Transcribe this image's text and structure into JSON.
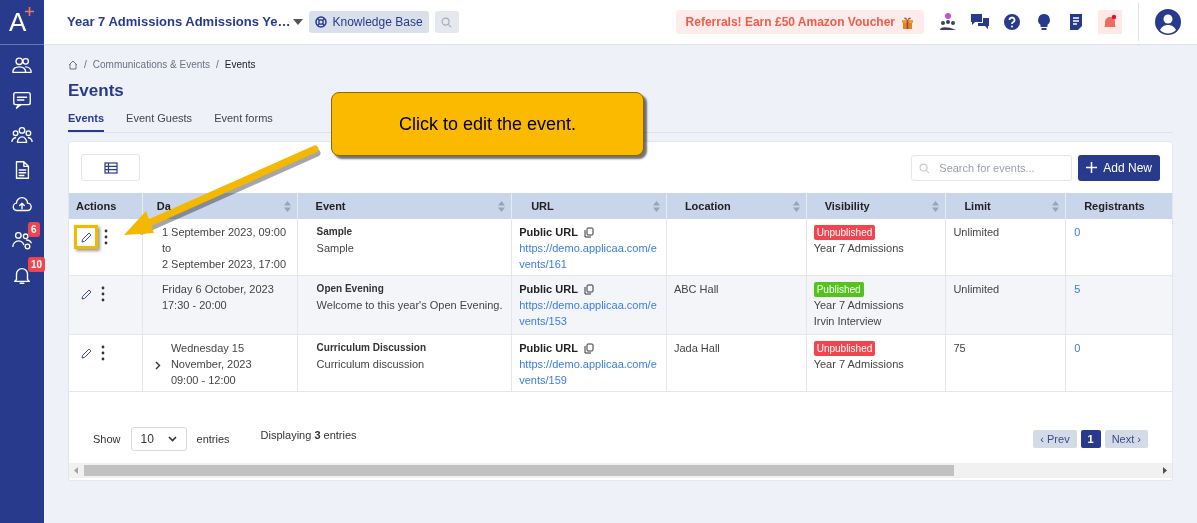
{
  "topbar": {
    "workspace": "Year 7 Admissions Admissions Ye…",
    "knowledge_base": "Knowledge Base",
    "referral": "Referrals! Earn £50 Amazon Voucher"
  },
  "sidebar": {
    "logo": "A",
    "items": [
      {
        "kind": "people"
      },
      {
        "kind": "chat"
      },
      {
        "kind": "group"
      },
      {
        "kind": "document"
      },
      {
        "kind": "upload"
      },
      {
        "kind": "group-settings",
        "badge": "6"
      },
      {
        "kind": "bell",
        "badge": "10"
      }
    ]
  },
  "breadcrumb": {
    "separator": "/",
    "items": [
      "Communications & Events",
      "Events"
    ]
  },
  "page_title": "Events",
  "tabs": [
    {
      "label": "Events",
      "selected": true
    },
    {
      "label": "Event Guests",
      "selected": false
    },
    {
      "label": "Event forms",
      "selected": false
    }
  ],
  "callout": "Click to edit the event.",
  "search": {
    "placeholder": "Search for events..."
  },
  "add_button": "Add New",
  "table": {
    "columns": [
      {
        "label": "Actions",
        "sortable": false
      },
      {
        "label": "Da",
        "sortable": true
      },
      {
        "label": "Event",
        "sortable": true
      },
      {
        "label": "URL",
        "sortable": true
      },
      {
        "label": "Location",
        "sortable": true
      },
      {
        "label": "Visibility",
        "sortable": true
      },
      {
        "label": "Limit",
        "sortable": true
      },
      {
        "label": "Registrants",
        "sortable": false
      }
    ],
    "rows": [
      {
        "highlighted": true,
        "expandable": false,
        "date": [
          "1 September 2023, 09:00",
          "to",
          "2 September 2023, 17:00"
        ],
        "event_title": "Sample",
        "event_description": "Sample",
        "url_label": "Public URL",
        "url": [
          "https://demo.applicaa.com/e",
          "vents/161"
        ],
        "location": "",
        "visibility": {
          "published": false,
          "label": "Unpublished",
          "lines": [
            "Year 7 Admissions"
          ]
        },
        "limit": "Unlimited",
        "registrants": "0"
      },
      {
        "highlighted": false,
        "expandable": false,
        "date": [
          "Friday 6 October, 2023",
          "17:30 - 20:00"
        ],
        "event_title": "Open Evening",
        "event_description": "Welcome to this year's Open Evening.",
        "url_label": "Public URL",
        "url": [
          "https://demo.applicaa.com/e",
          "vents/153"
        ],
        "location": "ABC Hall",
        "visibility": {
          "published": true,
          "label": "Published",
          "lines": [
            "Year 7 Admissions",
            "Irvin Interview"
          ]
        },
        "limit": "Unlimited",
        "registrants": "5"
      },
      {
        "highlighted": false,
        "expandable": true,
        "date": [
          "Wednesday 15",
          "November, 2023",
          "09:00 - 12:00"
        ],
        "event_title": "Curriculum Discussion",
        "event_description": "Curriculum discussion",
        "url_label": "Public URL",
        "url": [
          "https://demo.applicaa.com/e",
          "vents/159"
        ],
        "location": "Jada Hall",
        "visibility": {
          "published": false,
          "label": "Unpublished",
          "lines": [
            "Year 7 Admissions"
          ]
        },
        "limit": "75",
        "registrants": "0"
      }
    ]
  },
  "footer": {
    "show_label": "Show",
    "page_size": "10",
    "entries_label": "entries",
    "displaying": "Displaying **3** entries",
    "prev": "‹ Prev",
    "page": "1",
    "next": "Next ›"
  }
}
